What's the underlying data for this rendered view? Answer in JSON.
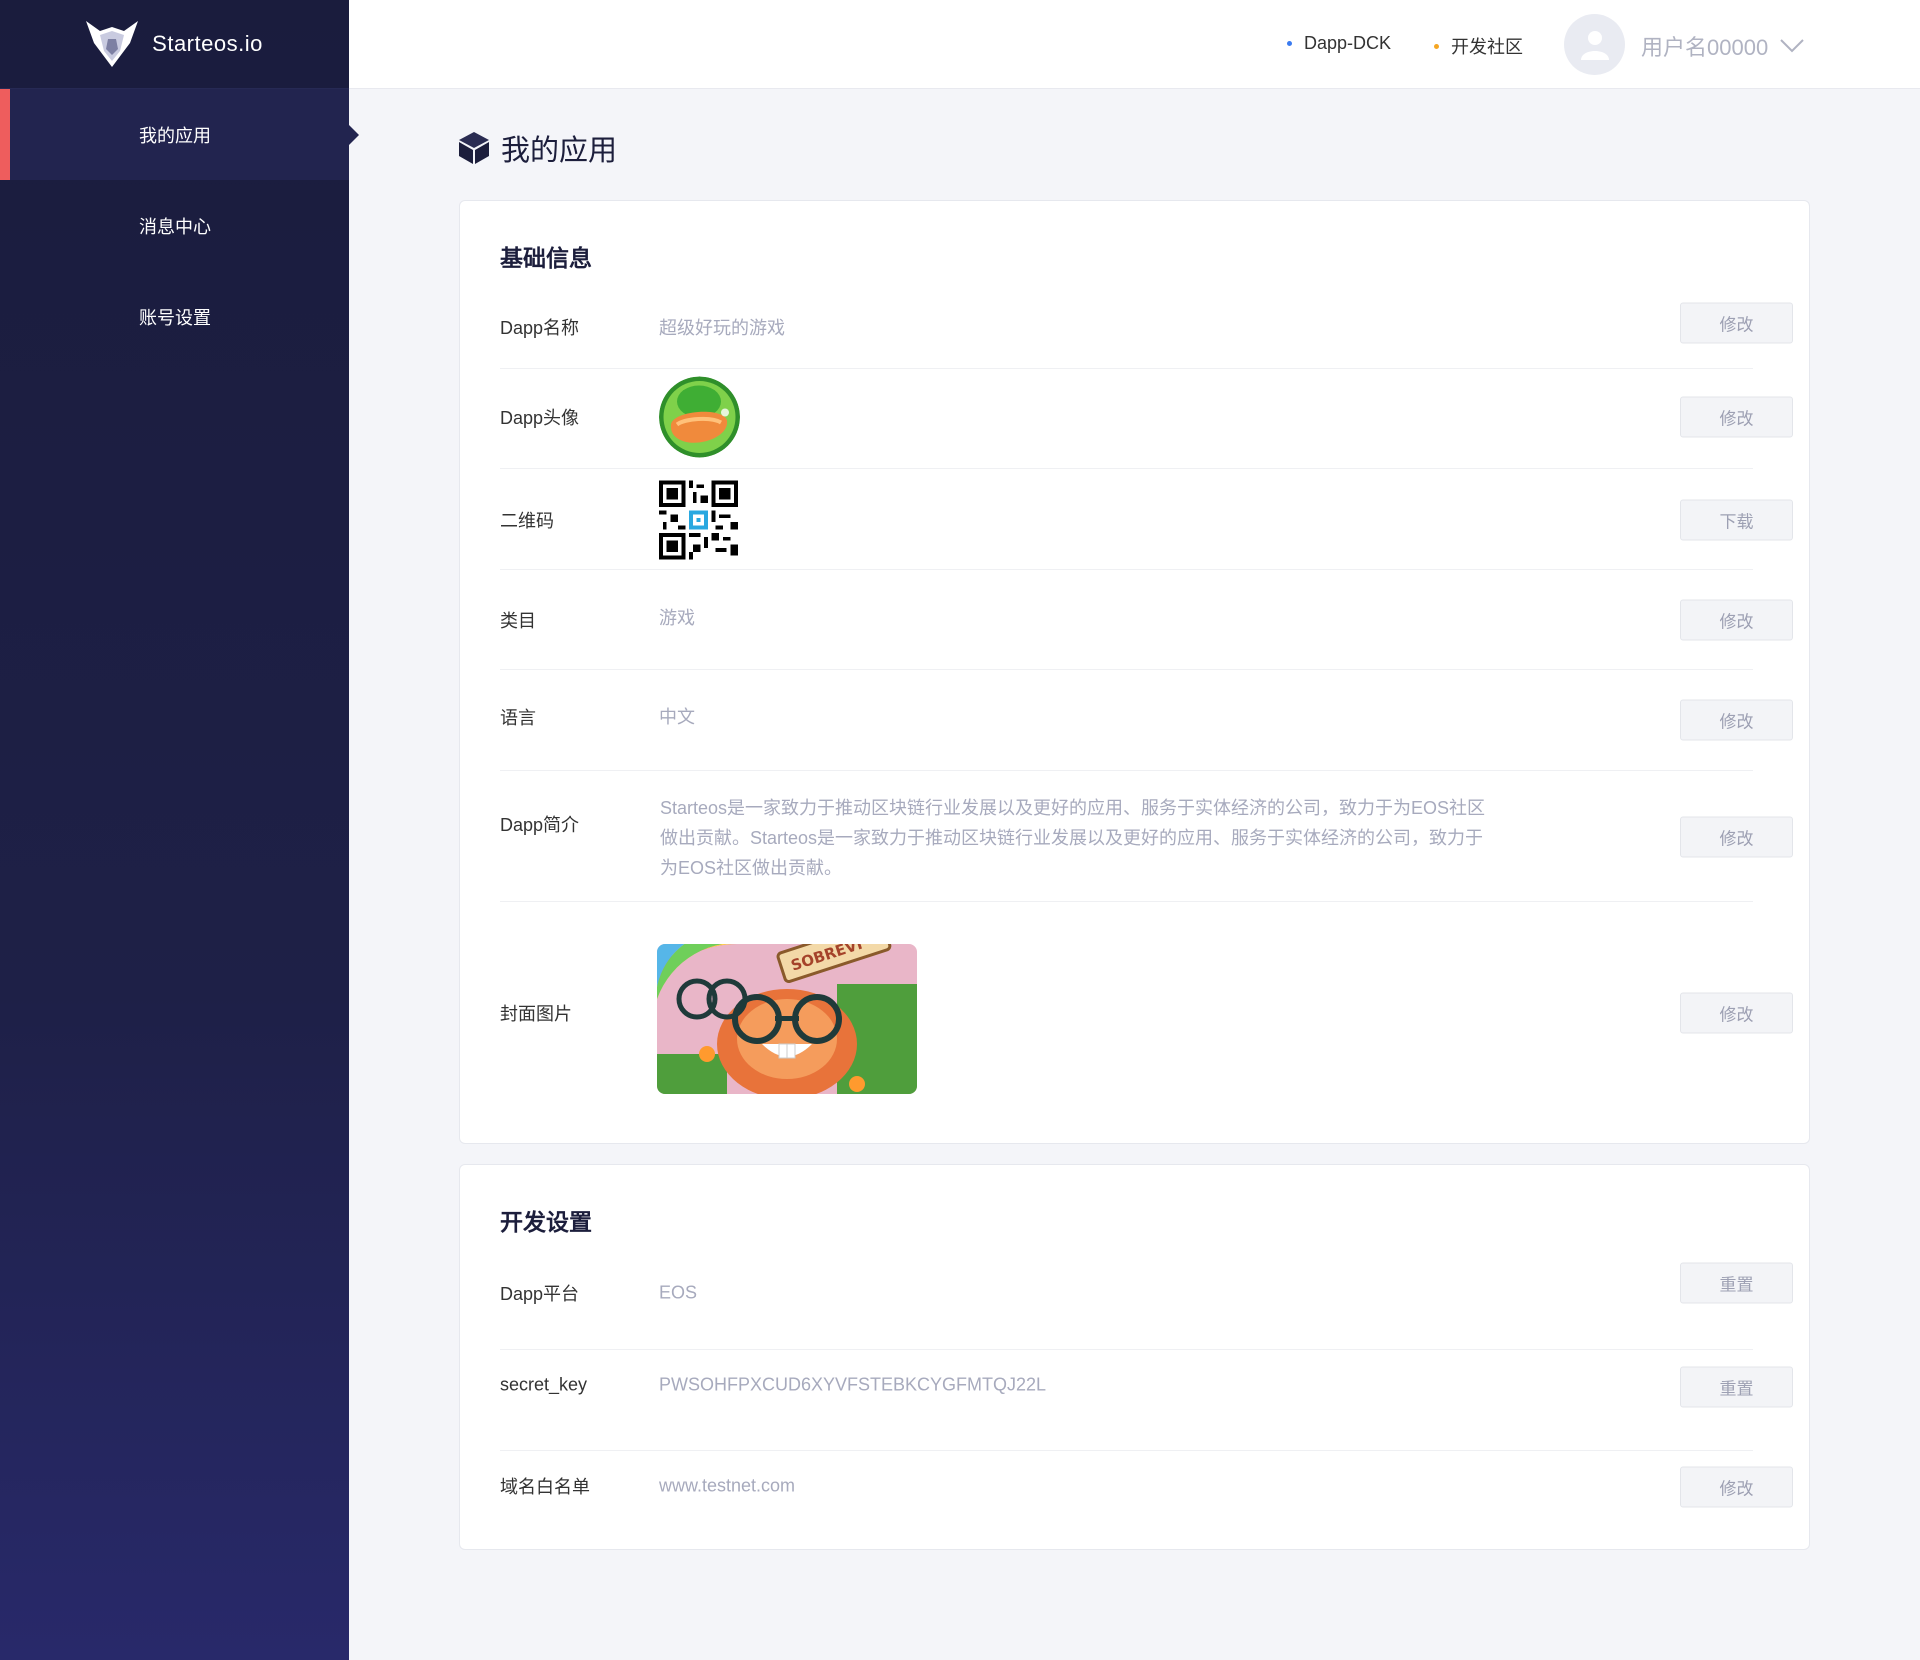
{
  "app": {
    "logo_text": "Starteos.io"
  },
  "sidebar": {
    "items": [
      {
        "label": "我的应用"
      },
      {
        "label": "消息中心"
      },
      {
        "label": "账号设置"
      }
    ]
  },
  "topbar": {
    "links": [
      {
        "label": "Dapp-DCK",
        "dot_color": "#3a7bf0"
      },
      {
        "label": "开发社区",
        "dot_color": "#f5a623"
      }
    ],
    "username": "用户名00000"
  },
  "page": {
    "title": "我的应用"
  },
  "basic_info": {
    "title": "基础信息",
    "rows": {
      "name": {
        "label": "Dapp名称",
        "value": "超级好玩的游戏",
        "button": "修改"
      },
      "avatar": {
        "label": "Dapp头像",
        "button": "修改"
      },
      "qrcode": {
        "label": "二维码",
        "button": "下载"
      },
      "category": {
        "label": "类目",
        "value": "游戏",
        "button": "修改"
      },
      "language": {
        "label": "语言",
        "value": "中文",
        "button": "修改"
      },
      "intro": {
        "label": "Dapp简介",
        "value": "Starteos是一家致力于推动区块链行业发展以及更好的应用、服务于实体经济的公司，致力于为EOS社区做出贡献。Starteos是一家致力于推动区块链行业发展以及更好的应用、服务于实体经济的公司，致力于为EOS社区做出贡献。",
        "button": "修改"
      },
      "cover": {
        "label": "封面图片",
        "button": "修改",
        "banner_text": "SOBREVI"
      }
    }
  },
  "dev_settings": {
    "title": "开发设置",
    "rows": {
      "platform": {
        "label": "Dapp平台",
        "value": "EOS",
        "button": "重置"
      },
      "secret_key": {
        "label": "secret_key",
        "value": "PWSOHFPXCUD6XYVFSTEBKCYGFMTQJ22L",
        "button": "重置"
      },
      "whitelist": {
        "label": "域名白名单",
        "value": "www.testnet.com",
        "button": "修改"
      }
    }
  }
}
